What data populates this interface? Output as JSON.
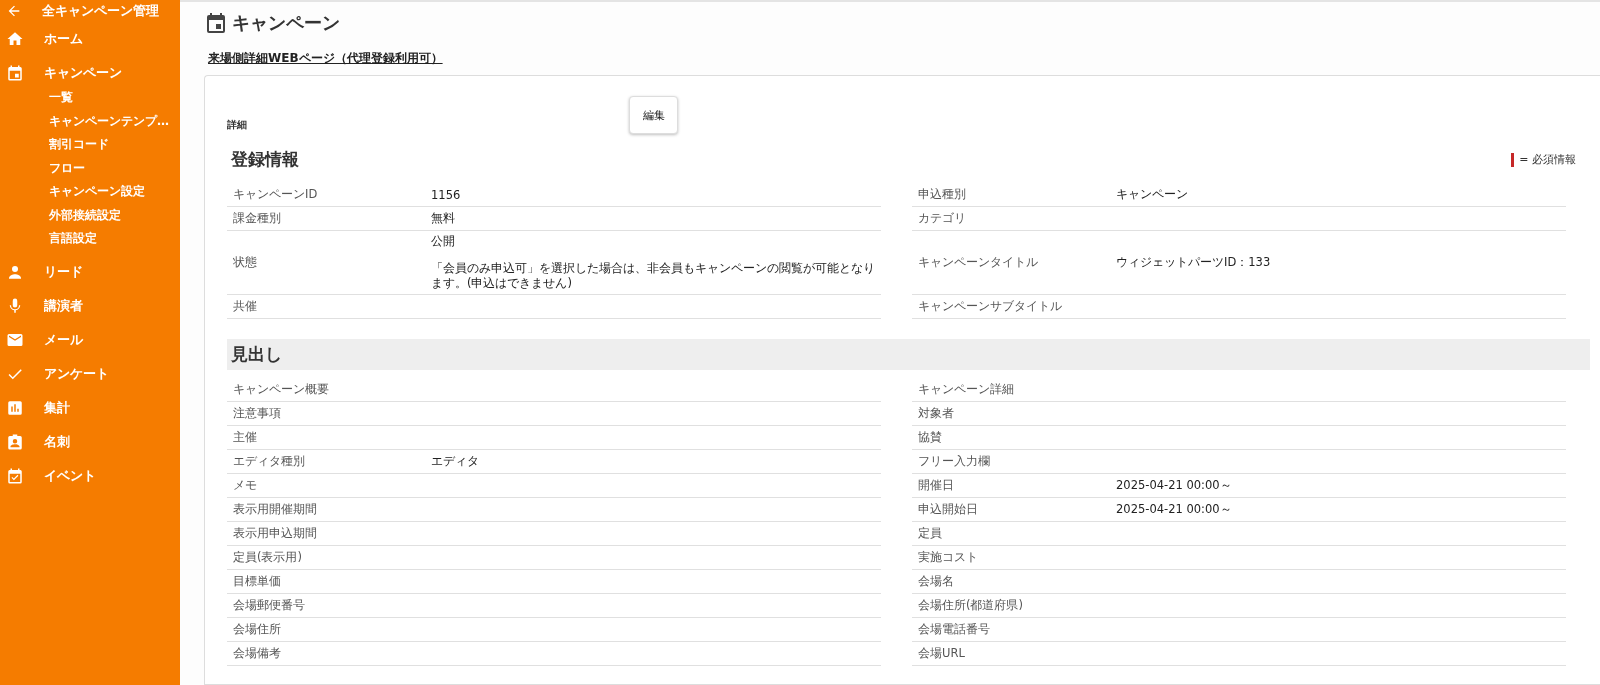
{
  "sidebar": {
    "back": {
      "label": "全キャンペーン管理"
    },
    "items": [
      {
        "kind": "home",
        "label": "ホーム"
      },
      {
        "kind": "calendar",
        "label": "キャンペーン",
        "children": [
          {
            "label": "一覧"
          },
          {
            "label": "キャンペーンテンプ…"
          },
          {
            "label": "割引コード"
          },
          {
            "label": "フロー"
          },
          {
            "label": "キャンペーン設定"
          },
          {
            "label": "外部接続設定"
          },
          {
            "label": "言語設定"
          }
        ]
      },
      {
        "kind": "person",
        "label": "リード"
      },
      {
        "kind": "mic",
        "label": "講演者"
      },
      {
        "kind": "mail",
        "label": "メール"
      },
      {
        "kind": "check",
        "label": "アンケート"
      },
      {
        "kind": "chart",
        "label": "集計"
      },
      {
        "kind": "badge",
        "label": "名刺"
      },
      {
        "kind": "event",
        "label": "イベント"
      }
    ]
  },
  "page": {
    "title": "キャンペーン",
    "link": "来場側詳細WEBページ（代理登録利用可）"
  },
  "card": {
    "label": "詳細",
    "edit_button": "編集",
    "required_legend": "= 必須情報",
    "sections": [
      {
        "title": "登録情報",
        "kind": "plain",
        "rows": [
          [
            {
              "label": "キャンペーンID",
              "value": "1156"
            },
            {
              "label": "申込種別",
              "value": "キャンペーン"
            }
          ],
          [
            {
              "label": "課金種別",
              "value": "無料"
            },
            {
              "label": "カテゴリ"
            }
          ],
          [
            {
              "label": "状態",
              "value": "公開",
              "note": "「会員のみ申込可」を選択した場合は、非会員もキャンペーンの閲覧が可能となります。(申込はできません)"
            },
            {
              "label": "キャンペーンタイトル",
              "value": "ウィジェットパーツID：133"
            }
          ],
          [
            {
              "label": "共催"
            },
            {
              "label": "キャンペーンサブタイトル"
            }
          ]
        ]
      },
      {
        "title": "見出し",
        "kind": "band",
        "rows": [
          [
            {
              "label": "キャンペーン概要"
            },
            {
              "label": "キャンペーン詳細"
            }
          ],
          [
            {
              "label": "注意事項"
            },
            {
              "label": "対象者"
            }
          ],
          [
            {
              "label": "主催"
            },
            {
              "label": "協賛"
            }
          ],
          [
            {
              "label": "エディタ種別",
              "value": "エディタ"
            },
            {
              "label": "フリー入力欄"
            }
          ],
          [
            {
              "label": "メモ"
            },
            {
              "label": "開催日",
              "value": "2025-04-21 00:00～"
            }
          ],
          [
            {
              "label": "表示用開催期間"
            },
            {
              "label": "申込開始日",
              "value": "2025-04-21 00:00～"
            }
          ],
          [
            {
              "label": "表示用申込期間"
            },
            {
              "label": "定員"
            }
          ],
          [
            {
              "label": "定員(表示用)"
            },
            {
              "label": "実施コスト"
            }
          ],
          [
            {
              "label": "目標単価"
            },
            {
              "label": "会場名"
            }
          ],
          [
            {
              "label": "会場郵便番号"
            },
            {
              "label": "会場住所(都道府県)"
            }
          ],
          [
            {
              "label": "会場住所"
            },
            {
              "label": "会場電話番号"
            }
          ],
          [
            {
              "label": "会場備考"
            },
            {
              "label": "会場URL"
            }
          ]
        ]
      }
    ]
  }
}
